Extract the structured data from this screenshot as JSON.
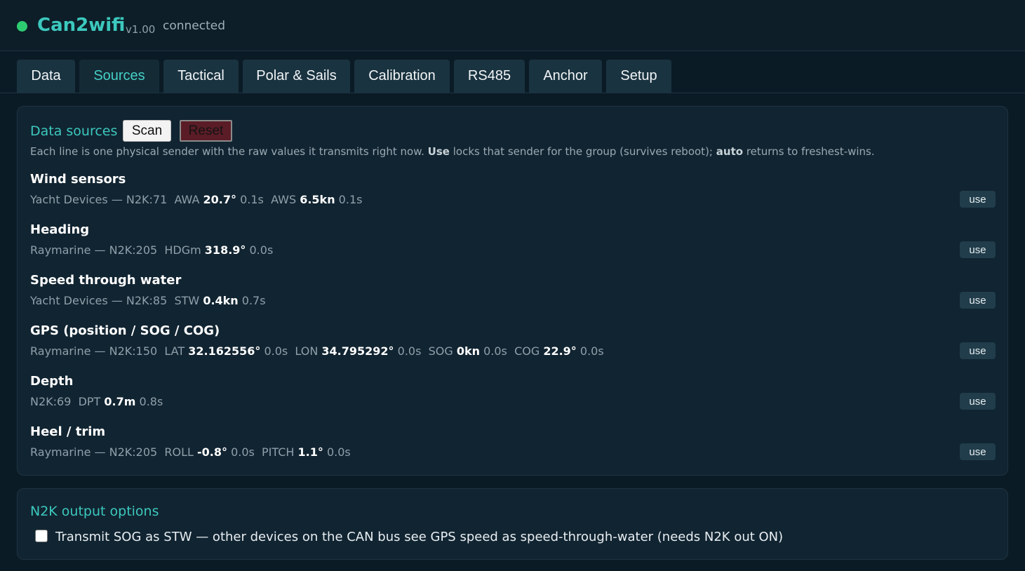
{
  "header": {
    "title": "Can2wifi",
    "version": "v1.00",
    "status": "connected",
    "status_color": "#2ecc71"
  },
  "tabs": [
    {
      "label": "Data"
    },
    {
      "label": "Sources",
      "active": true
    },
    {
      "label": "Tactical"
    },
    {
      "label": "Polar & Sails"
    },
    {
      "label": "Calibration"
    },
    {
      "label": "RS485"
    },
    {
      "label": "Anchor"
    },
    {
      "label": "Setup"
    }
  ],
  "sources": {
    "title": "Data sources",
    "scan_label": "Scan",
    "reset_label": "Reset",
    "desc_1": "Each line is one physical sender with the raw values it transmits right now.",
    "desc_use": "Use",
    "desc_2": "locks that sender for the group (survives reboot);",
    "desc_auto": "auto",
    "desc_3": "returns to freshest-wins.",
    "use_label": "use",
    "groups": [
      {
        "title": "Wind sensors",
        "sender": "Yacht Devices — N2K:71",
        "fields": [
          {
            "name": "AWA",
            "value": "20.7°",
            "age": "0.1s"
          },
          {
            "name": "AWS",
            "value": "6.5kn",
            "age": "0.1s"
          }
        ]
      },
      {
        "title": "Heading",
        "sender": "Raymarine — N2K:205",
        "fields": [
          {
            "name": "HDGm",
            "value": "318.9°",
            "age": "0.0s"
          }
        ]
      },
      {
        "title": "Speed through water",
        "sender": "Yacht Devices — N2K:85",
        "fields": [
          {
            "name": "STW",
            "value": "0.4kn",
            "age": "0.7s"
          }
        ]
      },
      {
        "title": "GPS (position / SOG / COG)",
        "sender": "Raymarine — N2K:150",
        "fields": [
          {
            "name": "LAT",
            "value": "32.162556°",
            "age": "0.0s"
          },
          {
            "name": "LON",
            "value": "34.795292°",
            "age": "0.0s"
          },
          {
            "name": "SOG",
            "value": "0kn",
            "age": "0.0s"
          },
          {
            "name": "COG",
            "value": "22.9°",
            "age": "0.0s"
          }
        ]
      },
      {
        "title": "Depth",
        "sender": "N2K:69",
        "fields": [
          {
            "name": "DPT",
            "value": "0.7m",
            "age": "0.8s"
          }
        ]
      },
      {
        "title": "Heel / trim",
        "sender": "Raymarine — N2K:205",
        "fields": [
          {
            "name": "ROLL",
            "value": "-0.8°",
            "age": "0.0s"
          },
          {
            "name": "PITCH",
            "value": "1.1°",
            "age": "0.0s"
          }
        ]
      }
    ]
  },
  "n2k_output": {
    "title": "N2K output options",
    "transmit_sog_label": "Transmit SOG as STW — other devices on the CAN bus see GPS speed as speed-through-water (needs N2K out ON)",
    "transmit_sog_checked": false
  }
}
